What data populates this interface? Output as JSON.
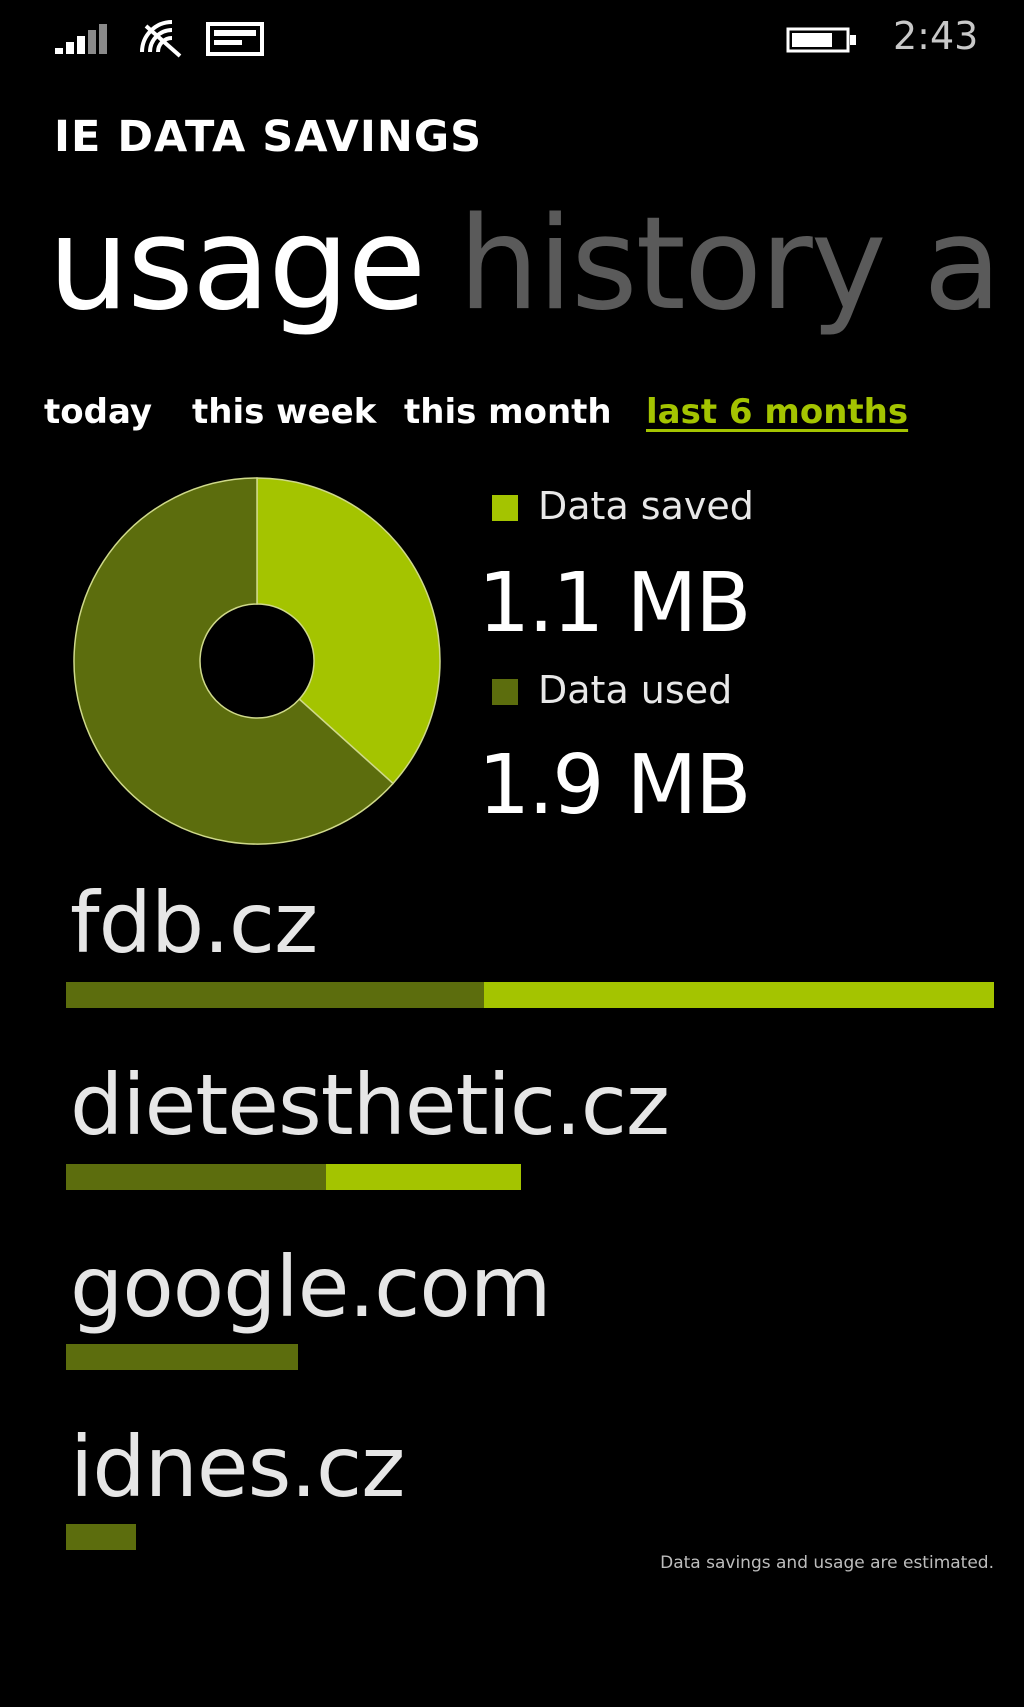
{
  "status_bar": {
    "time": "2:43",
    "icons": [
      "signal-icon",
      "wifi-icon",
      "message-icon",
      "battery-icon"
    ]
  },
  "app": {
    "title": "IE DATA SAVINGS"
  },
  "pivot": {
    "active_label": "usage",
    "inactive_label": "history a"
  },
  "filters": [
    {
      "label": "today",
      "selected": false
    },
    {
      "label": "this week",
      "selected": false
    },
    {
      "label": "this month",
      "selected": false
    },
    {
      "label": "last 6 months",
      "selected": true
    }
  ],
  "colors": {
    "accent": "#a4c400",
    "used": "#5c6d0d",
    "background": "#000000"
  },
  "chart_data": {
    "type": "pie",
    "series": [
      {
        "name": "Data saved",
        "value": 1.1,
        "label": "1.1 MB",
        "color": "#a4c400"
      },
      {
        "name": "Data used",
        "value": 1.9,
        "label": "1.9 MB",
        "color": "#5c6d0d"
      }
    ]
  },
  "sites": [
    {
      "name": "fdb.cz",
      "used": 0.45,
      "saved": 0.55
    },
    {
      "name": "dietesthetic.cz",
      "used": 0.28,
      "saved": 0.21
    },
    {
      "name": "google.com",
      "used": 0.25,
      "saved": 0.0
    },
    {
      "name": "idnes.cz",
      "used": 0.075,
      "saved": 0.0
    }
  ],
  "footnote": "Data savings and usage are estimated."
}
